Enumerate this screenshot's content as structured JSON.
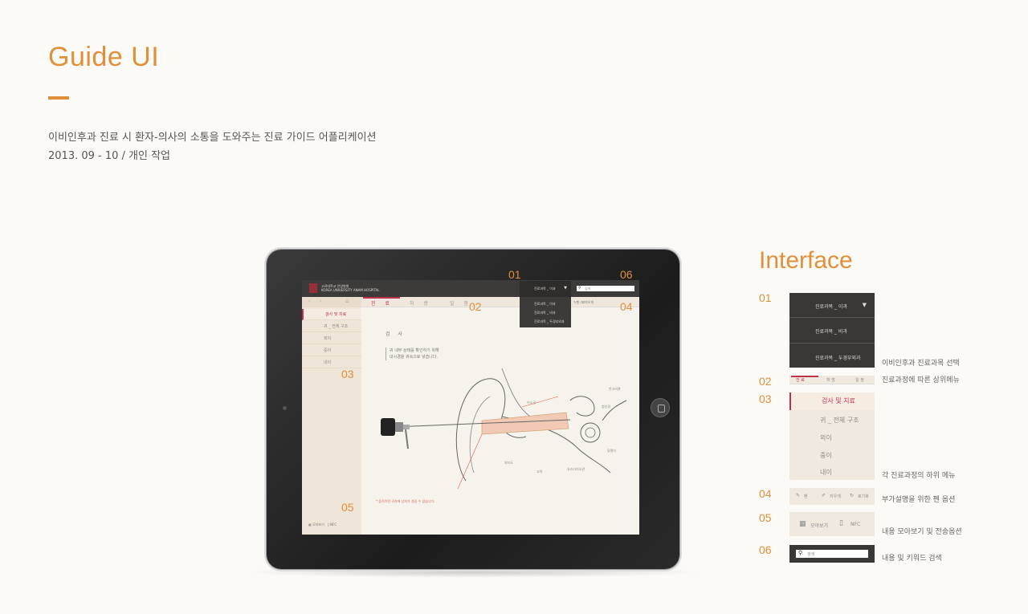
{
  "header": {
    "title": "Guide UI",
    "description": "이비인후과 진료 시 환자-의사의 소통을 도와주는 진료 가이드 어플리케이션",
    "meta": "2013. 09 - 10 / 개인 작업"
  },
  "app": {
    "hospital_name": "고려대학교 안암병원",
    "hospital_sub": "KOREA UNIVERSITY ANAM HOSPITAL",
    "dept_selected": "진료과목 _ 이과",
    "dept_options": [
      "진료과목 _ 이과",
      "진료과목 _ 비과",
      "진료과목 _ 두경부외과"
    ],
    "search_placeholder": "검색",
    "tabs": [
      "진 료",
      "처 방",
      "일 정"
    ],
    "pen_options": [
      "펜",
      "지우개",
      "로기화"
    ],
    "sidebar_items": [
      "검사 및 치료",
      "귀 _ 전체 구조",
      "외이",
      "중이",
      "내이"
    ],
    "sidebar_footer": [
      "모아보기",
      "NFC"
    ],
    "content_heading": "검 사",
    "content_text_1": "귀 내부 상태를 확인하기 위해",
    "content_text_2": "내시경을 귀속으로 넣습니다.",
    "content_note": "* 움직이면 귀속에 상처가 생길 수 있습니다.",
    "diagram_labels": [
      "반고리관",
      "달팽이",
      "청신경",
      "고막",
      "외이도",
      "유스타키오관",
      "이소골"
    ]
  },
  "markers": {
    "m01": "01",
    "m02": "02",
    "m03": "03",
    "m04": "04",
    "m05": "05",
    "m06": "06"
  },
  "interface": {
    "title": "Interface",
    "items": [
      {
        "num": "01",
        "desc": "이비인후과 진료과목 선택"
      },
      {
        "num": "02",
        "desc": "진료과정에 따른 상위메뉴"
      },
      {
        "num": "03",
        "desc": "각 진료과정의 하위 메뉴"
      },
      {
        "num": "04",
        "desc": "부가설명을 위한 펜 옵션"
      },
      {
        "num": "05",
        "desc": "내용 모아보기 및 전송옵션"
      },
      {
        "num": "06",
        "desc": "내용 및 키워드 검색"
      }
    ],
    "thumb01_options": [
      "진료과목 _ 이과",
      "진료과목 _ 비과",
      "진료과목 _ 두경부외과"
    ],
    "thumb02_tabs": [
      "진 료",
      "처 방",
      "일 정"
    ],
    "thumb03_items": [
      "검사 및 치료",
      "귀 _ 전체 구조",
      "외이",
      "중이",
      "내이"
    ],
    "thumb04_opts": [
      "펜",
      "지우개",
      "로기화"
    ],
    "thumb05_opts": [
      "모아보기",
      "NFC"
    ],
    "thumb06_placeholder": "검색"
  },
  "colors": {
    "accent": "#e0903a",
    "brand_red": "#c0324a",
    "dark": "#3a3836"
  }
}
